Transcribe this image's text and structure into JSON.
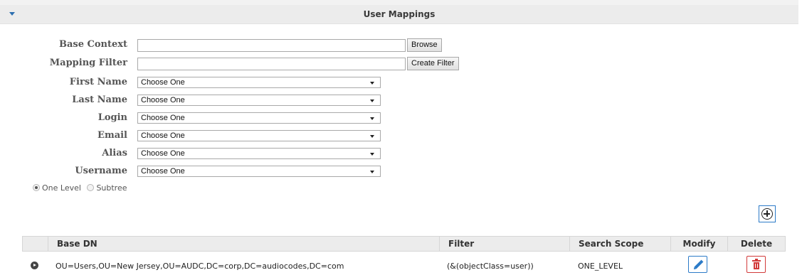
{
  "section": {
    "title": "User Mappings"
  },
  "form": {
    "base_context": {
      "label": "Base Context",
      "value": "",
      "browse_label": "Browse"
    },
    "mapping_filter": {
      "label": "Mapping Filter",
      "value": "",
      "create_filter_label": "Create Filter"
    },
    "selects": [
      {
        "label": "First Name",
        "value": "Choose One"
      },
      {
        "label": "Last Name",
        "value": "Choose One"
      },
      {
        "label": "Login",
        "value": "Choose One"
      },
      {
        "label": "Email",
        "value": "Choose One"
      },
      {
        "label": "Alias",
        "value": "Choose One"
      },
      {
        "label": "Username",
        "value": "Choose One"
      }
    ],
    "scope": {
      "options": [
        "One Level",
        "Subtree"
      ],
      "selected": "One Level"
    }
  },
  "table": {
    "headers": [
      "Base DN",
      "Filter",
      "Search Scope",
      "Modify",
      "Delete"
    ],
    "rows": [
      {
        "base_dn": "OU=Users,OU=New Jersey,OU=AUDC,DC=corp,DC=audiocodes,DC=com",
        "filter": "(&(objectClass=user))",
        "search_scope": "ONE_LEVEL"
      }
    ]
  },
  "icons": {
    "collapse": "chevron-down-icon",
    "add": "plus-circle-icon",
    "expand": "play-circle-icon",
    "edit": "pencil-icon",
    "delete": "trash-icon"
  },
  "colors": {
    "accent": "#2c7bc8",
    "danger": "#d23b3b",
    "header_bg": "#ececec"
  }
}
